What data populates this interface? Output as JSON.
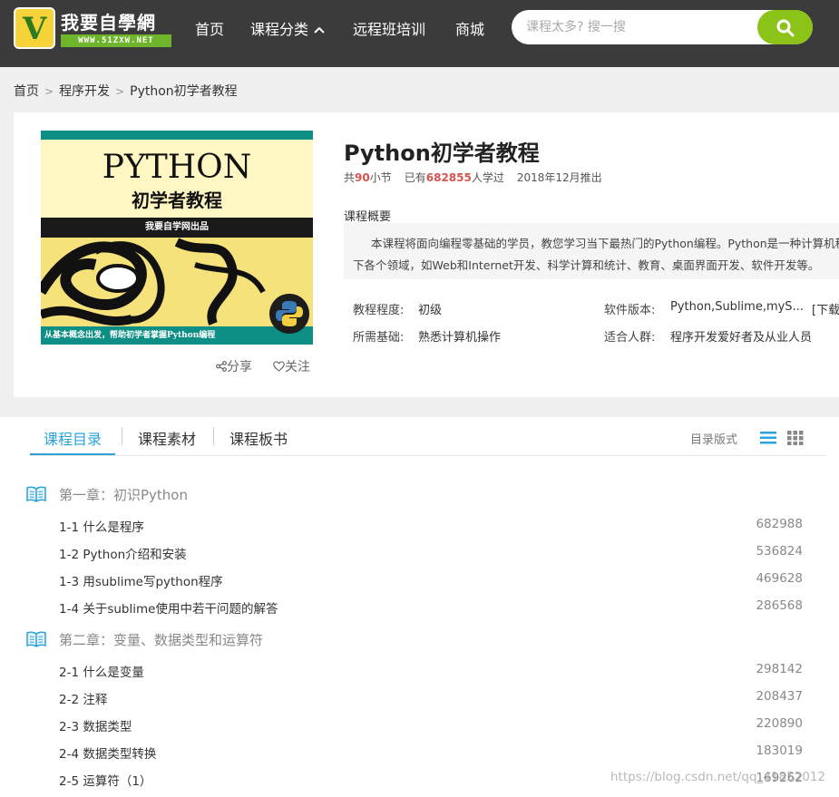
{
  "header": {
    "logo_title": "我要自學網",
    "logo_url": "WWW.51ZXW.NET",
    "nav": [
      {
        "label": "首页"
      },
      {
        "label": "课程分类"
      },
      {
        "label": "远程班培训"
      },
      {
        "label": "商城"
      }
    ],
    "search_placeholder": "课程太多? 搜一搜",
    "colors": {
      "topbar": "#3b3b3b",
      "search_button": "#8cc319",
      "accent": "#29a3d9"
    }
  },
  "breadcrumb": [
    "首页",
    "程序开发",
    "Python初学者教程"
  ],
  "course": {
    "cover": {
      "title": "PYTHON",
      "subtitle": "初学者教程",
      "band": "我要自学网出品",
      "tagline": "从基本概念出发，帮助初学者掌握Python编程"
    },
    "share_label": "分享",
    "follow_label": "关注",
    "title": "Python初学者教程",
    "meta": {
      "prefix": "共",
      "lessons": "90",
      "lessons_suffix": "小节",
      "learners_prefix": "已有",
      "learners": "682855",
      "learners_suffix": "人学过",
      "release": "2018年12月推出"
    },
    "overview_label": "课程概要",
    "overview_text": "本课程将面向编程零基础的学员，教您学习当下最热门的Python编程。Python是一种计算机程序设计语言，可以应用于以下各个领域，如Web和Internet开发、科学计算和统计、教育、桌面界面开发、软件开发等。",
    "info": {
      "level_label": "教程程度:",
      "level_value": "初级",
      "software_label": "软件版本:",
      "software_value": "Python,Sublime,myS...",
      "software_download": "[下载]",
      "basis_label": "所需基础:",
      "basis_value": "熟悉计算机操作",
      "audience_label": "适合人群:",
      "audience_value": "程序开发爱好者及从业人员"
    }
  },
  "contents": {
    "tabs": [
      {
        "label": "课程目录",
        "active": true
      },
      {
        "label": "课程素材",
        "active": false
      },
      {
        "label": "课程板书",
        "active": false
      }
    ],
    "layout_label": "目录版式",
    "chapters": [
      {
        "title": "第一章：初识Python",
        "lessons": [
          {
            "title": "1-1 什么是程序",
            "views": "682988"
          },
          {
            "title": "1-2 Python介绍和安装",
            "views": "536824"
          },
          {
            "title": "1-3 用sublime写python程序",
            "views": "469628"
          },
          {
            "title": "1-4 关于sublime使用中若干问题的解答",
            "views": "286568"
          }
        ]
      },
      {
        "title": "第二章：变量、数据类型和运算符",
        "lessons": [
          {
            "title": "2-1 什么是变量",
            "views": "298142"
          },
          {
            "title": "2-2 注释",
            "views": "208437"
          },
          {
            "title": "2-3 数据类型",
            "views": "220890"
          },
          {
            "title": "2-4 数据类型转换",
            "views": "183019"
          },
          {
            "title": "2-5 运算符（1）",
            "views": "169262"
          }
        ]
      }
    ]
  },
  "watermark": "https://blog.csdn.net/qq_41852012"
}
